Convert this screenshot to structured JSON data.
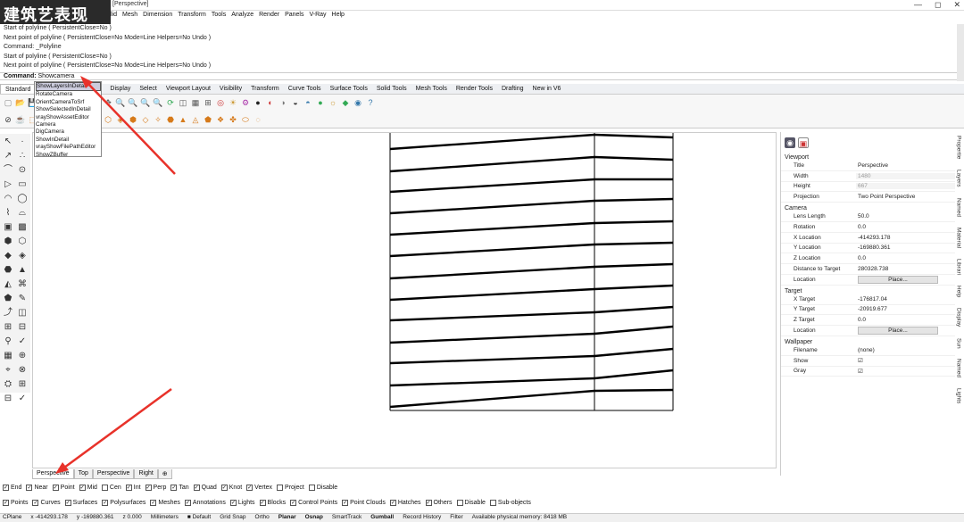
{
  "watermark": "建筑艺表现",
  "window": {
    "title": "[Perspective]",
    "min": "—",
    "max": "◻",
    "close": "✕"
  },
  "menu": [
    "lid",
    "Mesh",
    "Dimension",
    "Transform",
    "Tools",
    "Analyze",
    "Render",
    "Panels",
    "V-Ray",
    "Help"
  ],
  "history": [
    "Start of polyline ( PersistentClose=No )",
    "Next point of polyline ( PersistentClose=No  Mode=Line  Helpers=No  Undo )",
    "Command: _Polyline",
    "Start of polyline ( PersistentClose=No )",
    "Next point of polyline ( PersistentClose=No  Mode=Line  Helpers=No  Undo )"
  ],
  "command": {
    "label": "Command:",
    "value": "Showcamera"
  },
  "tabs": [
    "Standard",
    "",
    "Display",
    "Select",
    "Viewport Layout",
    "Visibility",
    "Transform",
    "Curve Tools",
    "Surface Tools",
    "Solid Tools",
    "Mesh Tools",
    "Render Tools",
    "Drafting",
    "New in V6"
  ],
  "autocomplete": [
    "ShowLayersInDetail",
    "RotateCamera",
    "OrientCameraToSrf",
    "ShowSelectedInDetail",
    "vrayShowAssetEditor",
    "Camera",
    "DigCamera",
    "ShowInDetail",
    "vrayShowFilePathEditor",
    "ShowZBuffer"
  ],
  "viewport_tabs": [
    "Perspective",
    "Top",
    "Perspective",
    "Right",
    "⊕"
  ],
  "snaps": [
    {
      "label": "End",
      "on": true
    },
    {
      "label": "Near",
      "on": true
    },
    {
      "label": "Point",
      "on": true
    },
    {
      "label": "Mid",
      "on": true
    },
    {
      "label": "Cen",
      "on": false
    },
    {
      "label": "Int",
      "on": true
    },
    {
      "label": "Perp",
      "on": true
    },
    {
      "label": "Tan",
      "on": true
    },
    {
      "label": "Quad",
      "on": true
    },
    {
      "label": "Knot",
      "on": true
    },
    {
      "label": "Vertex",
      "on": true
    },
    {
      "label": "Project",
      "on": false
    },
    {
      "label": "Disable",
      "on": false
    }
  ],
  "filters": [
    {
      "label": "Points",
      "on": true
    },
    {
      "label": "Curves",
      "on": true
    },
    {
      "label": "Surfaces",
      "on": true
    },
    {
      "label": "Polysurfaces",
      "on": true
    },
    {
      "label": "Meshes",
      "on": true
    },
    {
      "label": "Annotations",
      "on": true
    },
    {
      "label": "Lights",
      "on": true
    },
    {
      "label": "Blocks",
      "on": true
    },
    {
      "label": "Control Points",
      "on": true
    },
    {
      "label": "Point Clouds",
      "on": true
    },
    {
      "label": "Hatches",
      "on": true
    },
    {
      "label": "Others",
      "on": true
    },
    {
      "label": "Disable",
      "on": false
    },
    {
      "label": "Sub-objects",
      "on": false
    }
  ],
  "status": {
    "cplane": "CPlane",
    "x": "x -414293.178",
    "y": "y -169880.361",
    "z": "z 0.000",
    "units": "Millimeters",
    "layer": "Default",
    "gridsnap": "Grid Snap",
    "ortho": "Ortho",
    "planar": "Planar",
    "osnap": "Osnap",
    "smarttrack": "SmartTrack",
    "gumball": "Gumball",
    "record": "Record History",
    "filter": "Filter",
    "memory": "Available physical memory: 8418 MB"
  },
  "panel": {
    "viewport_title": "Viewport",
    "viewport": [
      {
        "k": "Title",
        "v": "Perspective"
      },
      {
        "k": "Width",
        "v": "1480",
        "dim": true
      },
      {
        "k": "Height",
        "v": "667",
        "dim": true
      },
      {
        "k": "Projection",
        "v": "Two Point Perspective"
      }
    ],
    "camera_title": "Camera",
    "camera": [
      {
        "k": "Lens Length",
        "v": "50.0"
      },
      {
        "k": "Rotation",
        "v": "0.0"
      },
      {
        "k": "X Location",
        "v": "-414293.178"
      },
      {
        "k": "Y Location",
        "v": "-169880.361"
      },
      {
        "k": "Z Location",
        "v": "0.0"
      },
      {
        "k": "Distance to Target",
        "v": "280328.738"
      }
    ],
    "camera_location": "Location",
    "place": "Place...",
    "target_title": "Target",
    "target": [
      {
        "k": "X Target",
        "v": "-176817.04"
      },
      {
        "k": "Y Target",
        "v": "-20919.677"
      },
      {
        "k": "Z Target",
        "v": "0.0"
      }
    ],
    "target_location": "Location",
    "wallpaper_title": "Wallpaper",
    "wallpaper": [
      {
        "k": "Filename",
        "v": "(none)"
      },
      {
        "k": "Show",
        "v": "☑"
      },
      {
        "k": "Gray",
        "v": "☑"
      }
    ]
  },
  "side_tabs": [
    "Propertie",
    "Layers",
    "Named",
    "Material",
    "Librari",
    "Help",
    "Display",
    "Sun",
    "Named",
    "Lights"
  ],
  "colors": {
    "arrow": "#e8322a"
  }
}
